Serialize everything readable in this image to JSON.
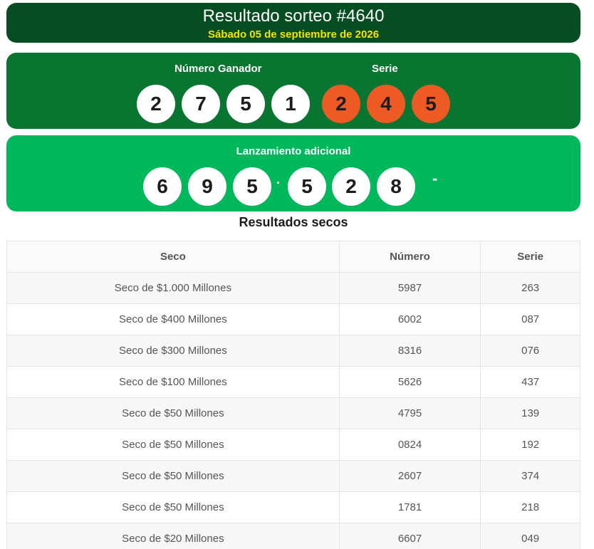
{
  "header": {
    "title": "Resultado sorteo #4640",
    "date": "Sábado 05 de septiembre de 2026"
  },
  "winner": {
    "number_label": "Número Ganador",
    "serie_label": "Serie",
    "number_digits": [
      "2",
      "7",
      "5",
      "1"
    ],
    "serie_digits": [
      "2",
      "4",
      "5"
    ]
  },
  "extra": {
    "label": "Lanzamiento adicional",
    "digits": [
      "6",
      "9",
      "5",
      "5",
      "2",
      "8"
    ],
    "dot": "·",
    "dash": "-"
  },
  "secos": {
    "title": "Resultados secos",
    "columns": [
      "Seco",
      "Número",
      "Serie"
    ],
    "rows": [
      {
        "prize": "Seco de $1.000 Millones",
        "number": "5987",
        "serie": "263"
      },
      {
        "prize": "Seco de $400 Millones",
        "number": "6002",
        "serie": "087"
      },
      {
        "prize": "Seco de $300 Millones",
        "number": "8316",
        "serie": "076"
      },
      {
        "prize": "Seco de $100 Millones",
        "number": "5626",
        "serie": "437"
      },
      {
        "prize": "Seco de $50 Millones",
        "number": "4795",
        "serie": "139"
      },
      {
        "prize": "Seco de $50 Millones",
        "number": "0824",
        "serie": "192"
      },
      {
        "prize": "Seco de $50 Millones",
        "number": "2607",
        "serie": "374"
      },
      {
        "prize": "Seco de $50 Millones",
        "number": "1781",
        "serie": "218"
      },
      {
        "prize": "Seco de $20 Millones",
        "number": "6607",
        "serie": "049"
      }
    ]
  },
  "colors": {
    "header_bg": "#064d22",
    "winner_bg": "#087530",
    "extra_bg": "#00b85c",
    "date_text": "#f4e400",
    "serie_ball": "#ee5a24"
  }
}
